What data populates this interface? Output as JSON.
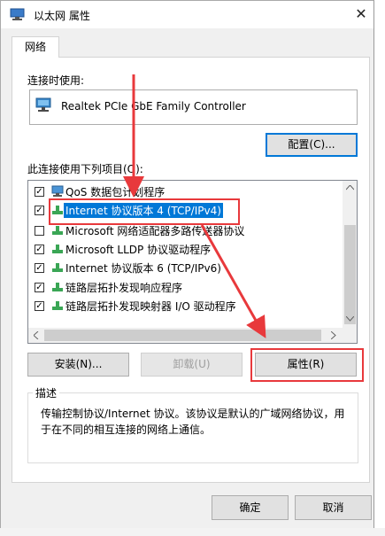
{
  "window": {
    "title": "以太网 属性",
    "close_glyph": "✕"
  },
  "tabs": [
    {
      "label": "网络"
    }
  ],
  "connect_using": {
    "label": "连接时使用:",
    "adapter_name": "Realtek PCIe GbE Family Controller",
    "configure_label": "配置(C)..."
  },
  "items": {
    "label": "此连接使用下列项目(O):",
    "list": [
      {
        "checked": true,
        "text": "QoS 数据包计划程序",
        "icon": "qos-scheduler-icon"
      },
      {
        "checked": true,
        "text": "Internet 协议版本 4 (TCP/IPv4)",
        "icon": "network-protocol-icon",
        "selected": true
      },
      {
        "checked": false,
        "text": "Microsoft 网络适配器多路传送器协议",
        "icon": "network-protocol-icon"
      },
      {
        "checked": true,
        "text": "Microsoft LLDP 协议驱动程序",
        "icon": "network-protocol-icon"
      },
      {
        "checked": true,
        "text": "Internet 协议版本 6 (TCP/IPv6)",
        "icon": "network-protocol-icon"
      },
      {
        "checked": true,
        "text": "链路层拓扑发现响应程序",
        "icon": "network-protocol-icon"
      },
      {
        "checked": true,
        "text": "链路层拓扑发现映射器 I/O 驱动程序",
        "icon": "network-protocol-icon"
      }
    ]
  },
  "buttons": {
    "install": "安装(N)...",
    "uninstall": "卸载(U)",
    "properties": "属性(R)",
    "ok": "确定",
    "cancel": "取消"
  },
  "description": {
    "title": "描述",
    "text": "传输控制协议/Internet 协议。该协议是默认的广域网络协议，用于在不同的相互连接的网络上通信。"
  },
  "colors": {
    "annotation_red": "#e8393c",
    "selection_blue": "#0078d7"
  }
}
